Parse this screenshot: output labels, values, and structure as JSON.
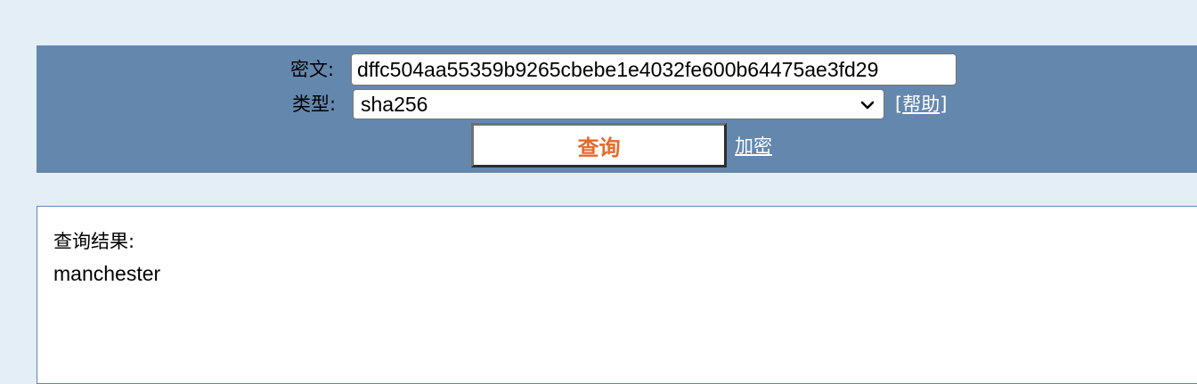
{
  "form": {
    "cipher_label": "密文:",
    "cipher_value": "dffc504aa55359b9265cbebe1e4032fe600b64475ae3fd29",
    "type_label": "类型:",
    "type_value": "sha256",
    "help_bracket_open": "[",
    "help_label": "帮助",
    "help_bracket_close": "]",
    "query_button_label": "查询",
    "encrypt_link_label": "加密"
  },
  "result": {
    "label": "查询结果:",
    "value": "manchester"
  },
  "colors": {
    "page_background": "#e4eef6",
    "panel_background": "#6487ae",
    "query_button_text": "#e46a2c"
  },
  "icons": {
    "select_arrow": "chevron-down-icon"
  }
}
